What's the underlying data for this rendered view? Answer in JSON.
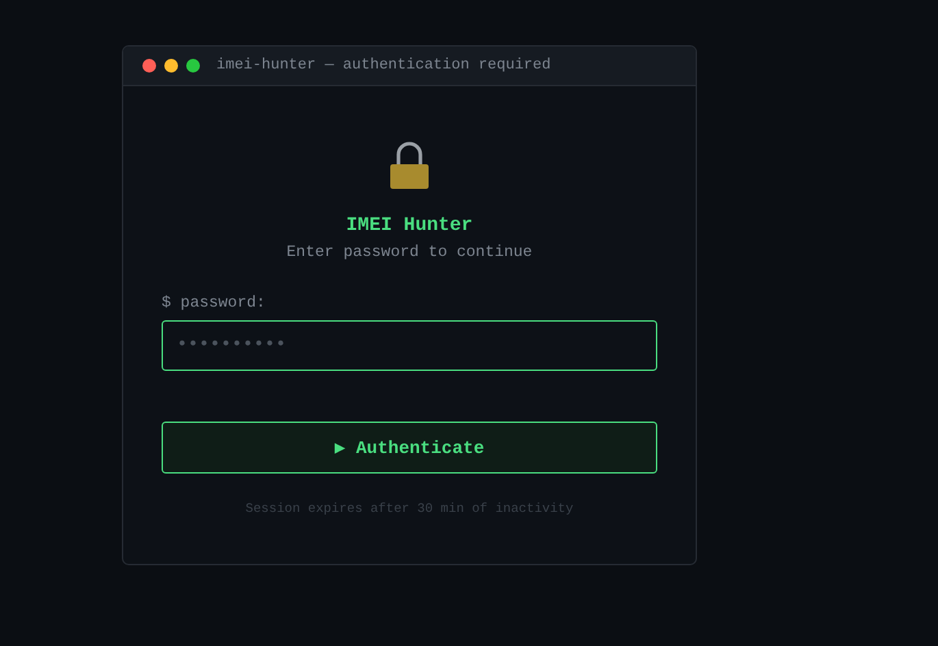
{
  "window": {
    "title": "imei-hunter — authentication required"
  },
  "app": {
    "title": "IMEI Hunter",
    "subtitle": "Enter password to continue"
  },
  "password": {
    "label": "$ password:",
    "placeholder": "••••••••••"
  },
  "button": {
    "label": "▶ Authenticate"
  },
  "footer": "Session expires after 30 min of inactivity"
}
